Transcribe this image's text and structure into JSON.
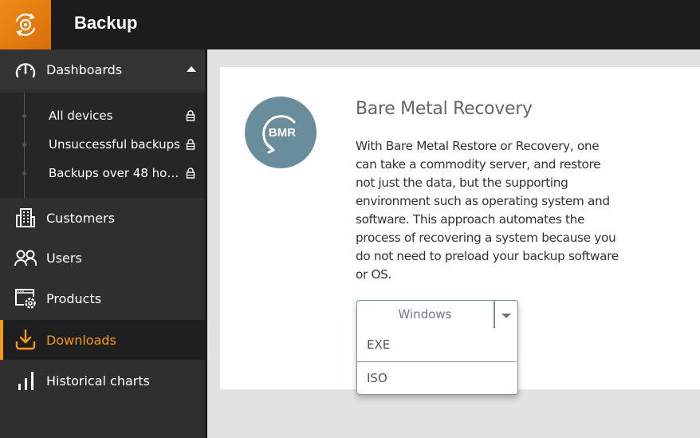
{
  "app": {
    "title": "Backup",
    "brand_color": "#f08c1a"
  },
  "sidebar": {
    "dashboards": {
      "label": "Dashboards",
      "expanded": true,
      "children": [
        {
          "label": "All devices",
          "locked": true
        },
        {
          "label": "Unsuccessful backups",
          "locked": true
        },
        {
          "label": "Backups over 48 ho…",
          "locked": true
        }
      ]
    },
    "items": [
      {
        "label": "Customers",
        "icon": "building-icon"
      },
      {
        "label": "Users",
        "icon": "users-icon"
      },
      {
        "label": "Products",
        "icon": "products-settings-icon"
      },
      {
        "label": "Downloads",
        "icon": "download-icon",
        "active": true
      },
      {
        "label": "Historical charts",
        "icon": "bar-chart-icon"
      }
    ],
    "active_color": "#f39a1e"
  },
  "card": {
    "icon_label": "BMR",
    "icon_color": "#6a8d9c",
    "title": "Bare Metal Recovery",
    "description": "With Bare Metal Restore or Recovery, one can take a commodity server, and restore not just the data, but the supporting environment such as operating system and software. This approach automates the process of recovering a system because you do not need to preload your backup software or OS.",
    "dropdown": {
      "selected": "Windows",
      "options": [
        "EXE",
        "ISO"
      ]
    }
  }
}
